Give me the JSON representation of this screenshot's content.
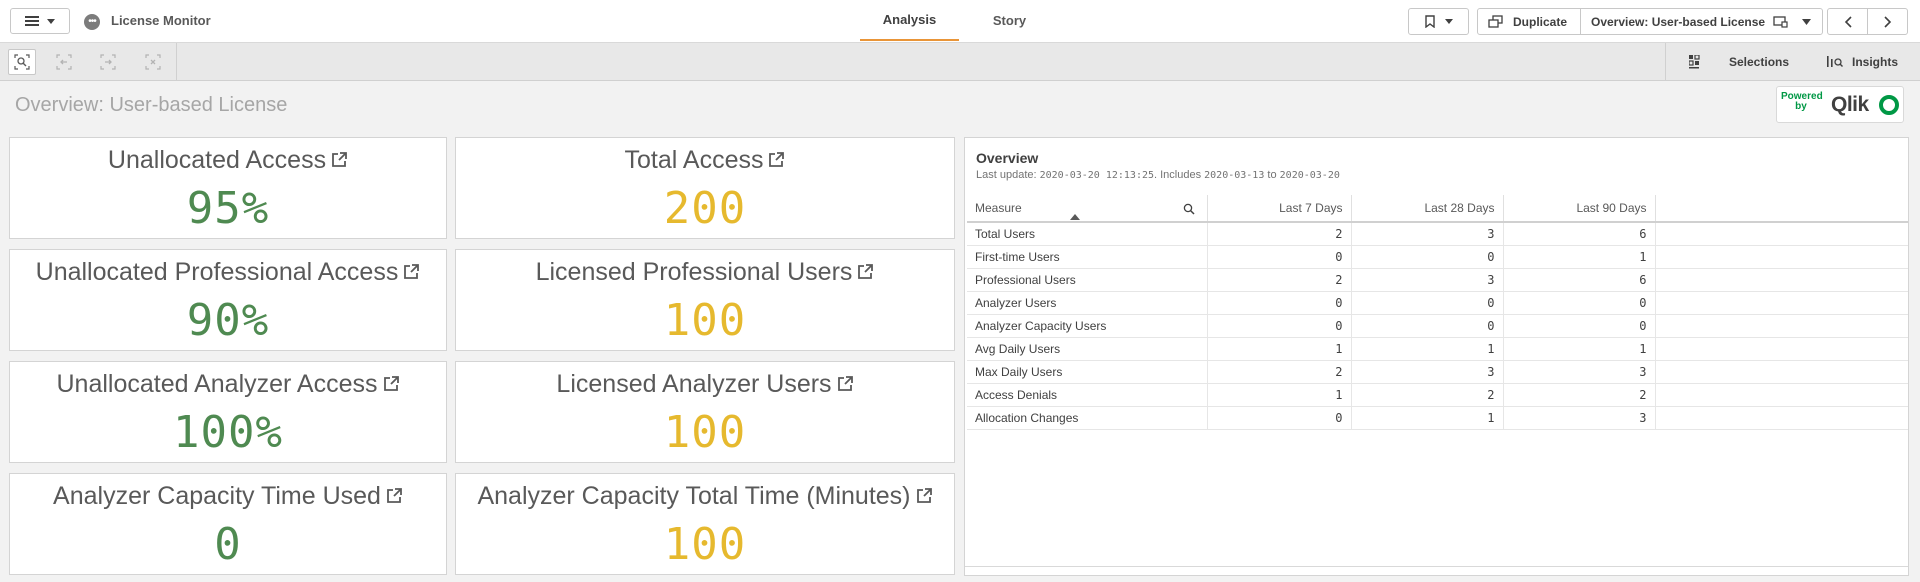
{
  "app": {
    "title": "License Monitor"
  },
  "nav": {
    "tabs": [
      {
        "label": "Analysis",
        "active": true
      },
      {
        "label": "Story",
        "active": false
      }
    ]
  },
  "header": {
    "duplicate_label": "Duplicate",
    "sheet_selector_label": "Overview: User-based License"
  },
  "toolbar": {
    "selections_label": "Selections",
    "insights_label": "Insights"
  },
  "sheet": {
    "title": "Overview: User-based License"
  },
  "branding": {
    "powered_line1": "Powered",
    "powered_line2": "by",
    "qlik_text": "Qlik"
  },
  "kpis": [
    {
      "title": "Unallocated Access",
      "value": "95%",
      "color": "#4f8a51"
    },
    {
      "title": "Total Access",
      "value": "200",
      "color": "#e6b92e"
    },
    {
      "title": "Unallocated Professional Access",
      "value": "90%",
      "color": "#4f8a51"
    },
    {
      "title": "Licensed Professional Users",
      "value": "100",
      "color": "#e6b92e"
    },
    {
      "title": "Unallocated Analyzer Access",
      "value": "100%",
      "color": "#4f8a51"
    },
    {
      "title": "Licensed Analyzer Users",
      "value": "100",
      "color": "#e6b92e"
    },
    {
      "title": "Analyzer Capacity Time Used",
      "value": "0",
      "color": "#4f8a51"
    },
    {
      "title": "Analyzer Capacity Total Time (Minutes)",
      "value": "100",
      "color": "#e6b92e"
    }
  ],
  "overview": {
    "title": "Overview",
    "subtitle_prefix": "Last update: ",
    "last_update": "2020-03-20 12:13:25",
    "subtitle_mid": ". Includes ",
    "range_start": "2020-03-13",
    "subtitle_to": " to ",
    "range_end": "2020-03-20",
    "columns": [
      "Measure",
      "Last 7 Days",
      "Last 28 Days",
      "Last 90 Days"
    ],
    "rows": [
      {
        "measure": "Total Users",
        "d7": "2",
        "d28": "3",
        "d90": "6"
      },
      {
        "measure": "First-time Users",
        "d7": "0",
        "d28": "0",
        "d90": "1"
      },
      {
        "measure": "Professional Users",
        "d7": "2",
        "d28": "3",
        "d90": "6"
      },
      {
        "measure": "Analyzer Users",
        "d7": "0",
        "d28": "0",
        "d90": "0"
      },
      {
        "measure": "Analyzer Capacity Users",
        "d7": "0",
        "d28": "0",
        "d90": "0"
      },
      {
        "measure": "Avg Daily Users",
        "d7": "1",
        "d28": "1",
        "d90": "1"
      },
      {
        "measure": "Max Daily Users",
        "d7": "2",
        "d28": "3",
        "d90": "3"
      },
      {
        "measure": "Access Denials",
        "d7": "1",
        "d28": "2",
        "d90": "2"
      },
      {
        "measure": "Allocation Changes",
        "d7": "0",
        "d28": "1",
        "d90": "3"
      }
    ]
  }
}
